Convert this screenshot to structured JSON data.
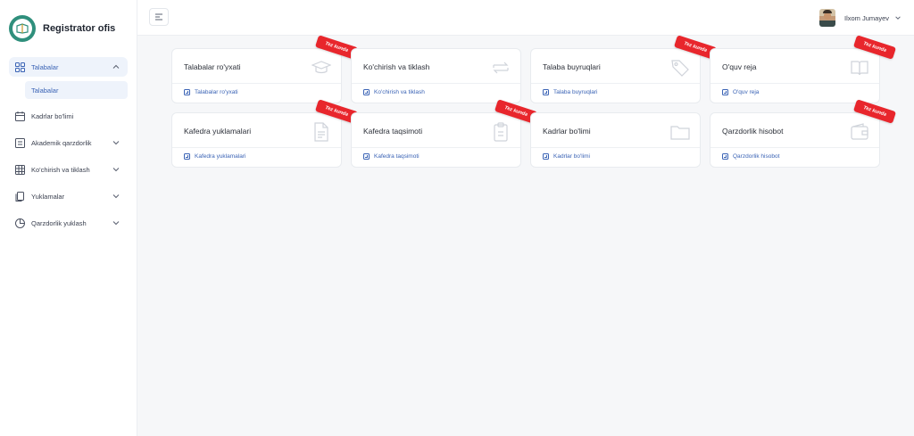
{
  "brand": {
    "name": "Registrator ofis"
  },
  "user": {
    "name": "Ilxom Jumayev"
  },
  "sidebar": {
    "items": [
      {
        "label": "Talabalar",
        "icon": "grid-icon",
        "expanded": true,
        "sub": [
          {
            "label": "Talabalar"
          }
        ]
      },
      {
        "label": "Kadrlar bo'limi",
        "icon": "calendar-icon"
      },
      {
        "label": "Akademik qarzdorlik",
        "icon": "list-icon"
      },
      {
        "label": "Ko'chirish va tiklash",
        "icon": "table-icon"
      },
      {
        "label": "Yuklamalar",
        "icon": "copy-icon"
      },
      {
        "label": "Qarzdorlik yuklash",
        "icon": "pie-icon"
      }
    ]
  },
  "ribbon_label": "Tez kunda",
  "cards": [
    {
      "title": "Talabalar ro'yxati",
      "link": "Talabalar ro'yxati",
      "icon": "graduation-cap-icon",
      "ribbon": true
    },
    {
      "title": "Ko'chirish va tiklash",
      "link": "Ko'chirish va tiklash",
      "icon": "transfer-icon",
      "ribbon": false
    },
    {
      "title": "Talaba buyruqlari",
      "link": "Talaba buyruqlari",
      "icon": "tag-icon",
      "ribbon": true
    },
    {
      "title": "O'quv reja",
      "link": "O'quv reja",
      "icon": "book-icon",
      "ribbon": true
    },
    {
      "title": "Kafedra yuklamalari",
      "link": "Kafedra yuklamalari",
      "icon": "document-icon",
      "ribbon": true
    },
    {
      "title": "Kafedra taqsimoti",
      "link": "Kafedra taqsimoti",
      "icon": "clipboard-icon",
      "ribbon": true
    },
    {
      "title": "Kadrlar bo'limi",
      "link": "Kadrlar bo'limi",
      "icon": "folder-icon",
      "ribbon": false
    },
    {
      "title": "Qarzdorlik hisobot",
      "link": "Qarzdorlik hisobot",
      "icon": "wallet-icon",
      "ribbon": true
    }
  ],
  "colors": {
    "accent": "#3a63b5",
    "ribbon": "#e8262c",
    "logo": "#2f8f7c"
  }
}
